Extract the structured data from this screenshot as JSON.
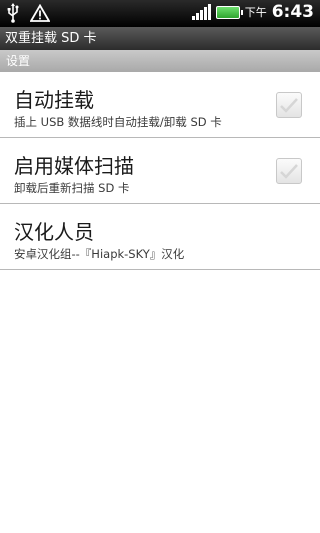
{
  "status_bar": {
    "icons": [
      "usb-icon",
      "warning-icon",
      "signal-icon",
      "battery-icon"
    ],
    "time_label": "下午",
    "time": "6:43"
  },
  "title_bar": {
    "title": "双重挂载 SD 卡"
  },
  "section": {
    "header": "设置"
  },
  "items": [
    {
      "title": "自动挂载",
      "summary": "插上 USB 数据线时自动挂载/卸载 SD 卡",
      "checked": false
    },
    {
      "title": "启用媒体扫描",
      "summary": "卸载后重新扫描 SD 卡",
      "checked": false
    },
    {
      "title": "汉化人员",
      "summary": "安卓汉化组--『Hiapk-SKY』汉化"
    }
  ]
}
